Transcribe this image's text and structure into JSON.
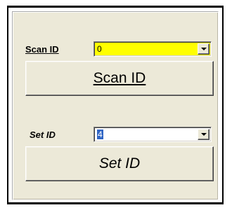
{
  "scan": {
    "label": "Scan ID",
    "value": "0",
    "button_label": "Scan ID",
    "field_color": "#ffff00"
  },
  "set": {
    "label": "Set ID",
    "value": "4",
    "button_label": "Set ID"
  },
  "icons": {
    "dropdown": "chevron-down-icon"
  }
}
